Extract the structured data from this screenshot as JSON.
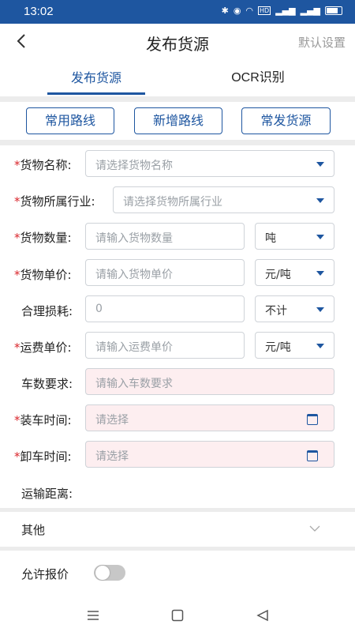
{
  "status_bar": {
    "time": "13:02",
    "icons": [
      "bluetooth-icon",
      "location-icon",
      "wifi-icon",
      "hd-icon",
      "signal-4g-icon",
      "signal-4g-icon",
      "battery-icon"
    ]
  },
  "nav": {
    "title": "发布货源",
    "right_label": "默认设置",
    "back_icon": "back-arrow-icon"
  },
  "tabs": [
    {
      "label": "发布货源",
      "active": true
    },
    {
      "label": "OCR识别",
      "active": false
    }
  ],
  "quick_buttons": [
    {
      "label": "常用路线"
    },
    {
      "label": "新增路线"
    },
    {
      "label": "常发货源"
    }
  ],
  "form": {
    "goods_name": {
      "label": "货物名称:",
      "placeholder": "请选择货物名称",
      "required": true
    },
    "industry": {
      "label": "货物所属行业:",
      "placeholder": "请选择货物所属行业",
      "required": true
    },
    "quantity": {
      "label": "货物数量:",
      "placeholder": "请输入货物数量",
      "unit": "吨",
      "required": true
    },
    "unit_price": {
      "label": "货物单价:",
      "placeholder": "请输入货物单价",
      "unit": "元/吨",
      "required": true
    },
    "loss": {
      "label": "合理损耗:",
      "value": "0",
      "unit": "不计",
      "required": false
    },
    "freight_price": {
      "label": "运费单价:",
      "placeholder": "请输入运费单价",
      "unit": "元/吨",
      "required": true
    },
    "truck_req": {
      "label": "车数要求:",
      "placeholder": "请输入车数要求",
      "required": false
    },
    "load_time": {
      "label": "装车时间:",
      "placeholder": "请选择",
      "required": true
    },
    "unload_time": {
      "label": "卸车时间:",
      "placeholder": "请选择",
      "required": true
    },
    "distance": {
      "label": "运输距离:"
    }
  },
  "required_mark": "*",
  "other": {
    "label": "其他"
  },
  "allow_bid": {
    "label": "允许报价",
    "on": false
  },
  "colors": {
    "primary": "#1e56a0",
    "required": "#d9262c",
    "pink_field": "#fdeef0"
  }
}
